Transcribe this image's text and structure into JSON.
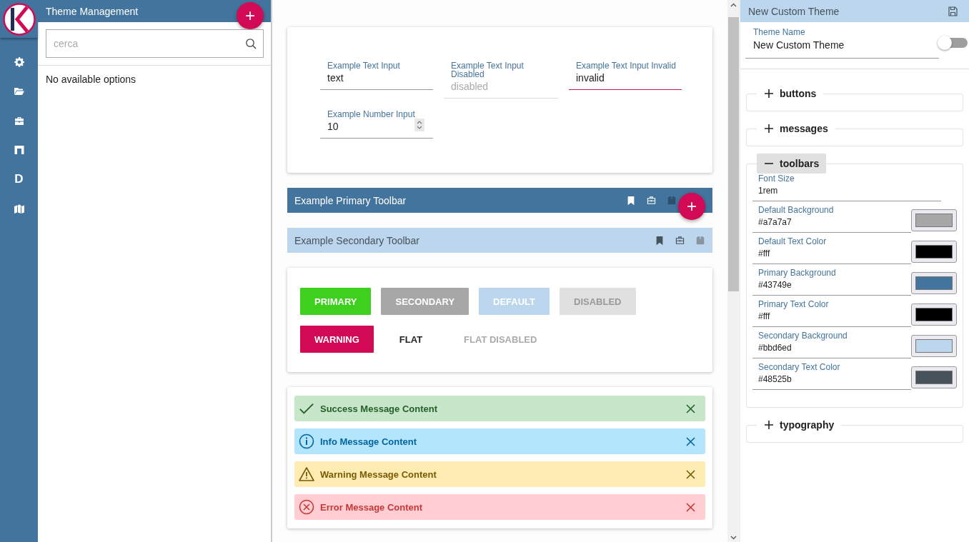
{
  "rail": {
    "letter_icon": "D"
  },
  "list_panel": {
    "title": "Theme Management",
    "add_button": "+",
    "search": {
      "placeholder": "cerca"
    },
    "empty_text": "No available options"
  },
  "inputs": [
    {
      "label": "Example Text Input",
      "value": "text",
      "disabled": false,
      "invalid": false,
      "kind": "text"
    },
    {
      "label": "Example Text Input Disabled",
      "value": "disabled",
      "disabled": true,
      "invalid": false,
      "kind": "text"
    },
    {
      "label": "Example Text Input Invalid",
      "value": "invalid",
      "disabled": false,
      "invalid": true,
      "kind": "text"
    },
    {
      "label": "Example Number Input",
      "value": "10",
      "disabled": false,
      "invalid": false,
      "kind": "number"
    }
  ],
  "toolbars": [
    {
      "kind": "primary",
      "title": "Example Primary Toolbar",
      "fab": "+"
    },
    {
      "kind": "secondary",
      "title": "Example Secondary Toolbar"
    }
  ],
  "buttons": [
    {
      "label": "PRIMARY",
      "kind": "primary",
      "disabled": false
    },
    {
      "label": "SECONDARY",
      "kind": "secondary",
      "disabled": false
    },
    {
      "label": "DEFAULT",
      "kind": "default",
      "disabled": false
    },
    {
      "label": "DISABLED",
      "kind": "default",
      "disabled": true
    },
    {
      "label": "WARNING",
      "kind": "warning",
      "disabled": false
    },
    {
      "label": "FLAT",
      "kind": "flat",
      "disabled": false
    },
    {
      "label": "FLAT DISABLED",
      "kind": "flat",
      "disabled": true
    }
  ],
  "messages": [
    {
      "kind": "success",
      "text": "Success Message Content"
    },
    {
      "kind": "info",
      "text": "Info Message Content"
    },
    {
      "kind": "warning",
      "text": "Warning Message Content"
    },
    {
      "kind": "error",
      "text": "Error Message Content"
    }
  ],
  "editor": {
    "title": "New Custom Theme",
    "theme_name": {
      "label": "Theme Name",
      "value": "New Custom Theme"
    },
    "toggle": {
      "on": false
    },
    "sections": [
      {
        "label": "buttons",
        "expanded": false
      },
      {
        "label": "messages",
        "expanded": false
      },
      {
        "label": "toolbars",
        "expanded": true,
        "font_size": {
          "label": "Font Size",
          "value": "1rem"
        },
        "fields": [
          {
            "label": "Default Background",
            "value": "#a7a7a7",
            "color": "#a7a7a7"
          },
          {
            "label": "Default Text Color",
            "value": "#fff",
            "color": "#000000"
          },
          {
            "label": "Primary Background",
            "value": "#43749e",
            "color": "#43749e"
          },
          {
            "label": "Primary Text Color",
            "value": "#fff",
            "color": "#000000"
          },
          {
            "label": "Secondary Background",
            "value": "#bbd6ed",
            "color": "#bbd6ed"
          },
          {
            "label": "Secondary Text Color",
            "value": "#48525b",
            "color": "#48525b"
          }
        ]
      },
      {
        "label": "typography",
        "expanded": false
      }
    ]
  }
}
